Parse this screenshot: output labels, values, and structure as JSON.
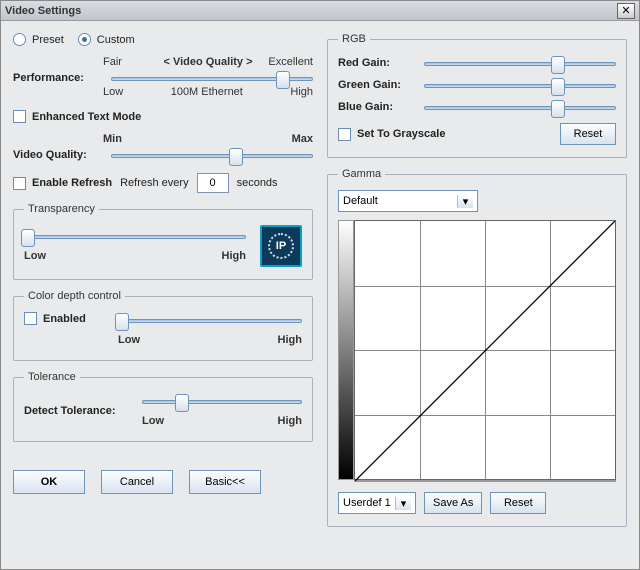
{
  "window": {
    "title": "Video Settings"
  },
  "mode": {
    "preset_label": "Preset",
    "custom_label": "Custom",
    "selected": "custom",
    "video_quality_header": "< Video Quality >"
  },
  "performance": {
    "label": "Performance:",
    "scale_left": "Fair",
    "scale_right": "Excellent",
    "tick_low": "Low",
    "tick_mid": "100M Ethernet",
    "tick_high": "High",
    "value_pct": 85
  },
  "enhanced_text": {
    "label": "Enhanced Text Mode",
    "checked": false
  },
  "video_quality": {
    "label": "Video Quality:",
    "min": "Min",
    "max": "Max",
    "value_pct": 62
  },
  "refresh": {
    "enable_label": "Enable Refresh",
    "checked": false,
    "every_label": "Refresh every",
    "value": "0",
    "unit": "seconds"
  },
  "transparency": {
    "legend": "Transparency",
    "low": "Low",
    "high": "High",
    "value_pct": 2
  },
  "color_depth": {
    "legend": "Color depth control",
    "enabled_label": "Enabled",
    "enabled_checked": false,
    "low": "Low",
    "high": "High",
    "value_pct": 2
  },
  "tolerance": {
    "legend": "Tolerance",
    "label": "Detect Tolerance:",
    "low": "Low",
    "high": "High",
    "value_pct": 25
  },
  "rgb": {
    "legend": "RGB",
    "red_label": "Red Gain:",
    "green_label": "Green Gain:",
    "blue_label": "Blue Gain:",
    "red_pct": 70,
    "green_pct": 70,
    "blue_pct": 70,
    "grayscale_label": "Set To Grayscale",
    "grayscale_checked": false,
    "reset_label": "Reset"
  },
  "gamma": {
    "legend": "Gamma",
    "preset_selected": "Default",
    "userdef_label": "Userdef 1",
    "save_as_label": "Save As",
    "reset_label": "Reset"
  },
  "buttons": {
    "ok": "OK",
    "cancel": "Cancel",
    "basic": "Basic<<"
  }
}
